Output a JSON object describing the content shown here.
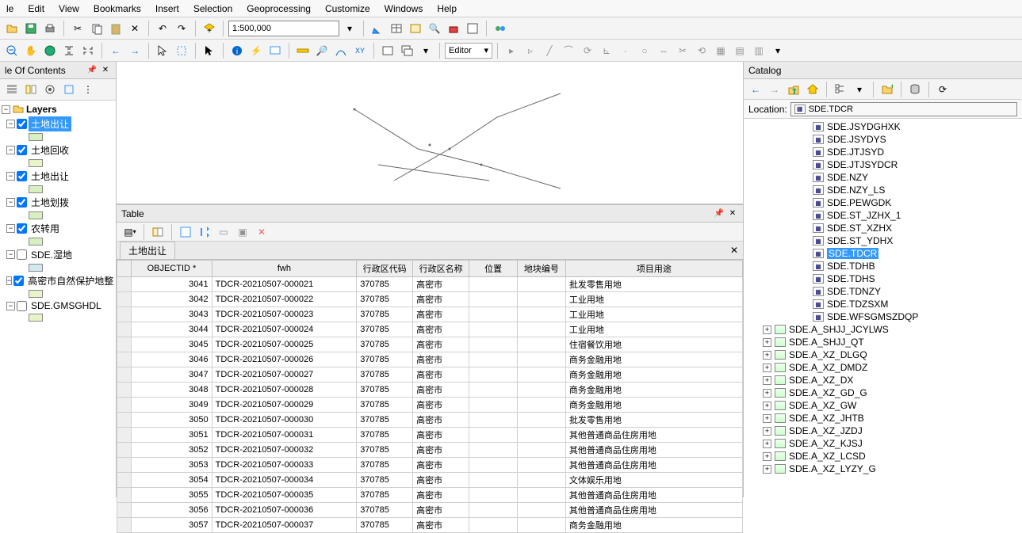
{
  "menu": [
    "le",
    "Edit",
    "View",
    "Bookmarks",
    "Insert",
    "Selection",
    "Geoprocessing",
    "Customize",
    "Windows",
    "Help"
  ],
  "scale": "1:500,000",
  "editor_label": "Editor",
  "toc": {
    "title": "le Of Contents",
    "layers_label": "Layers",
    "items": [
      {
        "label": "土地出让",
        "checked": true,
        "selected": true,
        "swatch": "#d8f0c0"
      },
      {
        "label": "土地回收",
        "checked": true,
        "selected": false,
        "swatch": "#e8f4c8"
      },
      {
        "label": "土地出让",
        "checked": true,
        "selected": false,
        "swatch": "#d8f0c0"
      },
      {
        "label": "土地划拨",
        "checked": true,
        "selected": false,
        "swatch": "#d8f0c0"
      },
      {
        "label": "农转用",
        "checked": true,
        "selected": false,
        "swatch": "#d8f0c0"
      },
      {
        "label": "SDE.湿地",
        "checked": false,
        "selected": false,
        "swatch": "#d0e8f0"
      },
      {
        "label": "高密市自然保护地整",
        "checked": true,
        "selected": false,
        "swatch": "#e8f4c8"
      },
      {
        "label": "SDE.GMSGHDL",
        "checked": false,
        "selected": false,
        "swatch": "#e8f4c8"
      }
    ]
  },
  "table": {
    "panel_title": "Table",
    "tab_title": "土地出让",
    "columns": [
      "OBJECTID *",
      "fwh",
      "行政区代码",
      "行政区名称",
      "位置",
      "地块编号",
      "项目用途"
    ],
    "rows": [
      {
        "oid": 3041,
        "fwh": "TDCR-20210507-000021",
        "code": "370785",
        "name": "高密市",
        "pos": "<Null>",
        "block": "<Null>",
        "usage": "批发零售用地"
      },
      {
        "oid": 3042,
        "fwh": "TDCR-20210507-000022",
        "code": "370785",
        "name": "高密市",
        "pos": "<Null>",
        "block": "<Null>",
        "usage": "工业用地"
      },
      {
        "oid": 3043,
        "fwh": "TDCR-20210507-000023",
        "code": "370785",
        "name": "高密市",
        "pos": "<Null>",
        "block": "<Null>",
        "usage": "工业用地"
      },
      {
        "oid": 3044,
        "fwh": "TDCR-20210507-000024",
        "code": "370785",
        "name": "高密市",
        "pos": "<Null>",
        "block": "<Null>",
        "usage": "工业用地"
      },
      {
        "oid": 3045,
        "fwh": "TDCR-20210507-000025",
        "code": "370785",
        "name": "高密市",
        "pos": "<Null>",
        "block": "<Null>",
        "usage": "住宿餐饮用地"
      },
      {
        "oid": 3046,
        "fwh": "TDCR-20210507-000026",
        "code": "370785",
        "name": "高密市",
        "pos": "<Null>",
        "block": "<Null>",
        "usage": "商务金融用地"
      },
      {
        "oid": 3047,
        "fwh": "TDCR-20210507-000027",
        "code": "370785",
        "name": "高密市",
        "pos": "<Null>",
        "block": "<Null>",
        "usage": "商务金融用地"
      },
      {
        "oid": 3048,
        "fwh": "TDCR-20210507-000028",
        "code": "370785",
        "name": "高密市",
        "pos": "<Null>",
        "block": "<Null>",
        "usage": "商务金融用地"
      },
      {
        "oid": 3049,
        "fwh": "TDCR-20210507-000029",
        "code": "370785",
        "name": "高密市",
        "pos": "<Null>",
        "block": "<Null>",
        "usage": "商务金融用地"
      },
      {
        "oid": 3050,
        "fwh": "TDCR-20210507-000030",
        "code": "370785",
        "name": "高密市",
        "pos": "<Null>",
        "block": "<Null>",
        "usage": "批发零售用地"
      },
      {
        "oid": 3051,
        "fwh": "TDCR-20210507-000031",
        "code": "370785",
        "name": "高密市",
        "pos": "<Null>",
        "block": "<Null>",
        "usage": "其他普通商品住房用地"
      },
      {
        "oid": 3052,
        "fwh": "TDCR-20210507-000032",
        "code": "370785",
        "name": "高密市",
        "pos": "<Null>",
        "block": "<Null>",
        "usage": "其他普通商品住房用地"
      },
      {
        "oid": 3053,
        "fwh": "TDCR-20210507-000033",
        "code": "370785",
        "name": "高密市",
        "pos": "<Null>",
        "block": "<Null>",
        "usage": "其他普通商品住房用地"
      },
      {
        "oid": 3054,
        "fwh": "TDCR-20210507-000034",
        "code": "370785",
        "name": "高密市",
        "pos": "<Null>",
        "block": "<Null>",
        "usage": "文体娱乐用地"
      },
      {
        "oid": 3055,
        "fwh": "TDCR-20210507-000035",
        "code": "370785",
        "name": "高密市",
        "pos": "<Null>",
        "block": "<Null>",
        "usage": "其他普通商品住房用地"
      },
      {
        "oid": 3056,
        "fwh": "TDCR-20210507-000036",
        "code": "370785",
        "name": "高密市",
        "pos": "<Null>",
        "block": "<Null>",
        "usage": "其他普通商品住房用地"
      },
      {
        "oid": 3057,
        "fwh": "TDCR-20210507-000037",
        "code": "370785",
        "name": "高密市",
        "pos": "<Null>",
        "block": "<Null>",
        "usage": "商务金融用地"
      }
    ]
  },
  "catalog": {
    "title": "Catalog",
    "location_label": "Location:",
    "location_value": "SDE.TDCR",
    "items": [
      {
        "type": "fc",
        "label": "SDE.JSYDGHXK"
      },
      {
        "type": "fc",
        "label": "SDE.JSYDYS"
      },
      {
        "type": "fc",
        "label": "SDE.JTJSYD"
      },
      {
        "type": "fc",
        "label": "SDE.JTJSYDCR"
      },
      {
        "type": "fc",
        "label": "SDE.NZY"
      },
      {
        "type": "fc",
        "label": "SDE.NZY_LS"
      },
      {
        "type": "fc",
        "label": "SDE.PEWGDK"
      },
      {
        "type": "fc",
        "label": "SDE.ST_JZHX_1"
      },
      {
        "type": "fc",
        "label": "SDE.ST_XZHX"
      },
      {
        "type": "fc",
        "label": "SDE.ST_YDHX"
      },
      {
        "type": "fc",
        "label": "SDE.TDCR",
        "selected": true
      },
      {
        "type": "fc",
        "label": "SDE.TDHB"
      },
      {
        "type": "fc",
        "label": "SDE.TDHS"
      },
      {
        "type": "fc",
        "label": "SDE.TDNZY"
      },
      {
        "type": "fc",
        "label": "SDE.TDZSXM"
      },
      {
        "type": "fc",
        "label": "SDE.WFSGMSZDQP"
      },
      {
        "type": "ds",
        "label": "SDE.A_SHJJ_JCYLWS"
      },
      {
        "type": "ds",
        "label": "SDE.A_SHJJ_QT"
      },
      {
        "type": "ds",
        "label": "SDE.A_XZ_DLGQ"
      },
      {
        "type": "ds",
        "label": "SDE.A_XZ_DMDZ"
      },
      {
        "type": "ds",
        "label": "SDE.A_XZ_DX"
      },
      {
        "type": "ds",
        "label": "SDE.A_XZ_GD_G"
      },
      {
        "type": "ds",
        "label": "SDE.A_XZ_GW"
      },
      {
        "type": "ds",
        "label": "SDE.A_XZ_JHTB"
      },
      {
        "type": "ds",
        "label": "SDE.A_XZ_JZDJ"
      },
      {
        "type": "ds",
        "label": "SDE.A_XZ_KJSJ"
      },
      {
        "type": "ds",
        "label": "SDE.A_XZ_LCSD"
      },
      {
        "type": "ds",
        "label": "SDE.A_XZ_LYZY_G"
      }
    ]
  }
}
